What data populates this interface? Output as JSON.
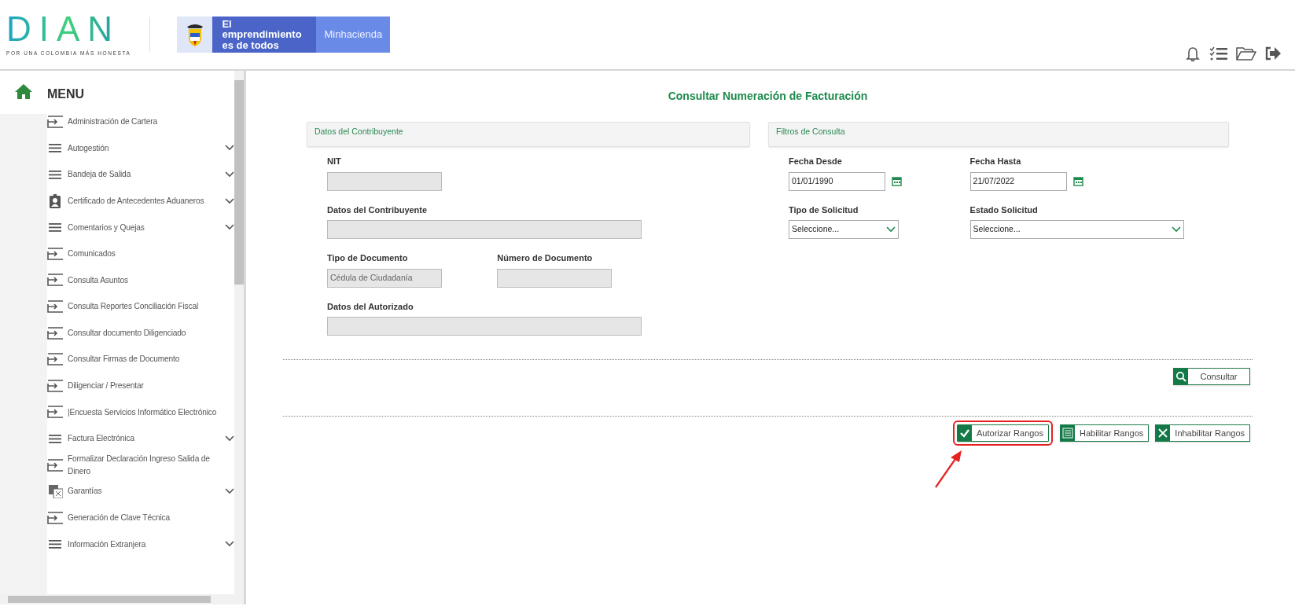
{
  "header": {
    "logo": "DIAN",
    "tagline": "POR UNA COLOMBIA MÁS HONESTA",
    "banner_text": "El emprendimiento es de todos",
    "banner_ministry": "Minhacienda"
  },
  "sidebar": {
    "title": "MENU",
    "items": [
      {
        "label": "Administración de Cartera",
        "kind": "link",
        "expandable": false
      },
      {
        "label": "Autogestión",
        "kind": "group",
        "expandable": true
      },
      {
        "label": "Bandeja de Salida",
        "kind": "group",
        "expandable": true
      },
      {
        "label": "Certificado de Antecedentes Aduaneros",
        "kind": "certificate",
        "expandable": true
      },
      {
        "label": "Comentarios y Quejas",
        "kind": "group",
        "expandable": true
      },
      {
        "label": "Comunicados",
        "kind": "link",
        "expandable": false
      },
      {
        "label": "Consulta Asuntos",
        "kind": "link",
        "expandable": false
      },
      {
        "label": "Consulta Reportes Conciliación Fiscal",
        "kind": "link",
        "expandable": false
      },
      {
        "label": "Consultar documento Diligenciado",
        "kind": "link",
        "expandable": false
      },
      {
        "label": "Consultar Firmas de Documento",
        "kind": "link",
        "expandable": false
      },
      {
        "label": "Diligenciar / Presentar",
        "kind": "link",
        "expandable": false
      },
      {
        "label": "|Encuesta Servicios Informático Electrónico",
        "kind": "link",
        "expandable": false
      },
      {
        "label": "Factura Electrónica",
        "kind": "group",
        "expandable": true
      },
      {
        "label": "Formalizar Declaración Ingreso Salida de Dinero",
        "kind": "link",
        "expandable": false
      },
      {
        "label": "Garantías",
        "kind": "guarantee",
        "expandable": true
      },
      {
        "label": "Generación de Clave Técnica",
        "kind": "link",
        "expandable": false
      },
      {
        "label": "Información Extranjera",
        "kind": "group",
        "expandable": true
      }
    ]
  },
  "page_title": "Consultar Numeración de Facturación",
  "panels": [
    {
      "title": "Datos del Contribuyente",
      "rows": [
        [
          {
            "label": "NIT",
            "kind": "text",
            "disabled": true
          }
        ],
        [
          {
            "label": "Datos del Contribuyente",
            "kind": "text",
            "disabled": true
          }
        ],
        [
          {
            "label": "Tipo de Documento",
            "kind": "text",
            "disabled": true,
            "value": "Cédula de Ciudadanía"
          },
          {
            "label": "Número de Documento",
            "kind": "text",
            "disabled": true
          }
        ],
        [
          {
            "label": "Datos del Autorizado",
            "kind": "text",
            "disabled": true
          }
        ]
      ]
    },
    {
      "title": "Filtros de Consulta",
      "rows": [
        [
          {
            "label": "Fecha Desde",
            "kind": "date",
            "disabled": false,
            "value": "01/01/1990"
          },
          {
            "label": "Fecha Hasta",
            "kind": "date",
            "disabled": false,
            "value": "21/07/2022"
          }
        ],
        [
          {
            "label": "Tipo de Solicitud",
            "kind": "select",
            "disabled": false,
            "value": "Seleccione..."
          },
          {
            "label": "Estado Solicitud",
            "kind": "select",
            "disabled": false,
            "value": "Seleccione..."
          }
        ]
      ]
    }
  ],
  "search_button": {
    "label": "Consultar"
  },
  "actions": [
    {
      "label": "Autorizar Rangos",
      "kind": "check",
      "highlighted": true
    },
    {
      "label": "Habilitar Rangos",
      "kind": "checklist",
      "highlighted": false
    },
    {
      "label": "Inhabilitar Rangos",
      "kind": "cross",
      "highlighted": false
    }
  ]
}
